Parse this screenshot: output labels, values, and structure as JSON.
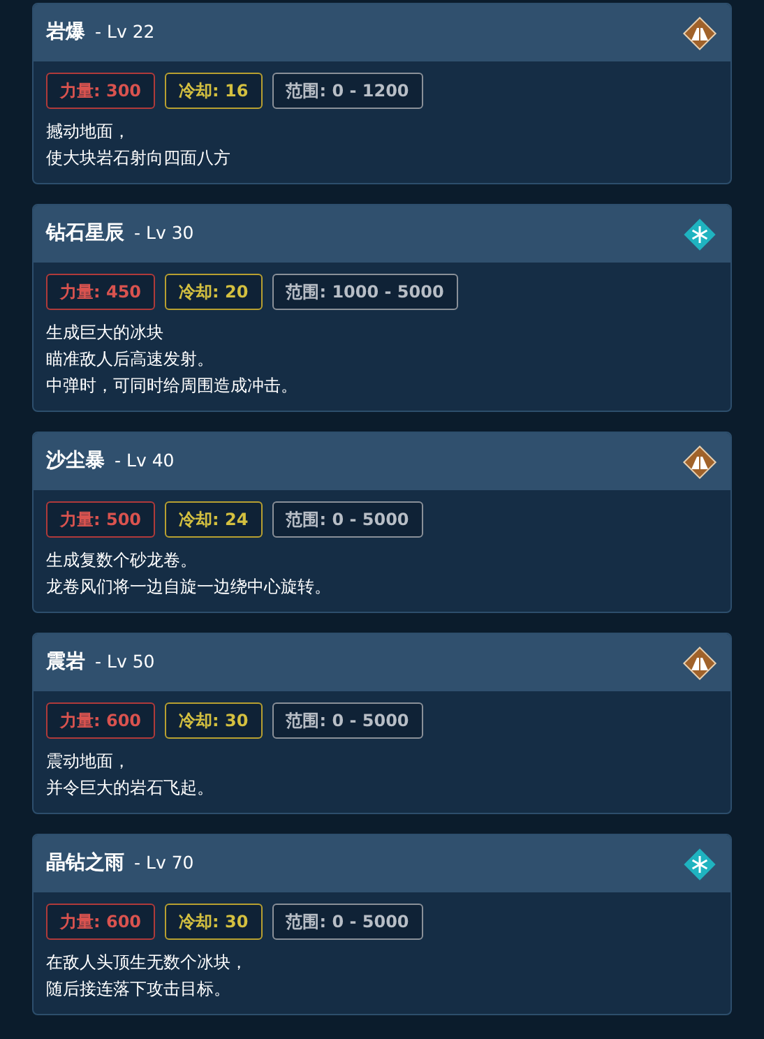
{
  "skills": [
    {
      "name": "岩爆",
      "level": "- Lv 22",
      "kind": "rock",
      "stats": [
        {
          "kind": "power",
          "text": "力量: 300"
        },
        {
          "kind": "cooldown",
          "text": "冷却: 16"
        },
        {
          "kind": "range",
          "text": "范围: 0 - 1200"
        }
      ],
      "description": [
        "撼动地面，",
        "使大块岩石射向四面八方"
      ]
    },
    {
      "name": "钻石星辰",
      "level": "- Lv 30",
      "kind": "ice",
      "stats": [
        {
          "kind": "power",
          "text": "力量: 450"
        },
        {
          "kind": "cooldown",
          "text": "冷却: 20"
        },
        {
          "kind": "range",
          "text": "范围: 1000 - 5000"
        }
      ],
      "description": [
        "生成巨大的冰块",
        "瞄准敌人后高速发射。",
        "中弹时，可同时给周围造成冲击。"
      ]
    },
    {
      "name": "沙尘暴",
      "level": "- Lv 40",
      "kind": "rock",
      "stats": [
        {
          "kind": "power",
          "text": "力量: 500"
        },
        {
          "kind": "cooldown",
          "text": "冷却: 24"
        },
        {
          "kind": "range",
          "text": "范围: 0 - 5000"
        }
      ],
      "description": [
        "生成复数个砂龙卷。",
        "龙卷风们将一边自旋一边绕中心旋转。"
      ]
    },
    {
      "name": "震岩",
      "level": "- Lv 50",
      "kind": "rock",
      "stats": [
        {
          "kind": "power",
          "text": "力量: 600"
        },
        {
          "kind": "cooldown",
          "text": "冷却: 30"
        },
        {
          "kind": "range",
          "text": "范围: 0 - 5000"
        }
      ],
      "description": [
        "震动地面，",
        "并令巨大的岩石飞起。"
      ]
    },
    {
      "name": "晶钻之雨",
      "level": "- Lv 70",
      "kind": "ice",
      "stats": [
        {
          "kind": "power",
          "text": "力量: 600"
        },
        {
          "kind": "cooldown",
          "text": "冷却: 30"
        },
        {
          "kind": "range",
          "text": "范围: 0 - 5000"
        }
      ],
      "description": [
        "在敌人头顶生无数个冰块，",
        "随后接连落下攻击目标。"
      ]
    }
  ]
}
